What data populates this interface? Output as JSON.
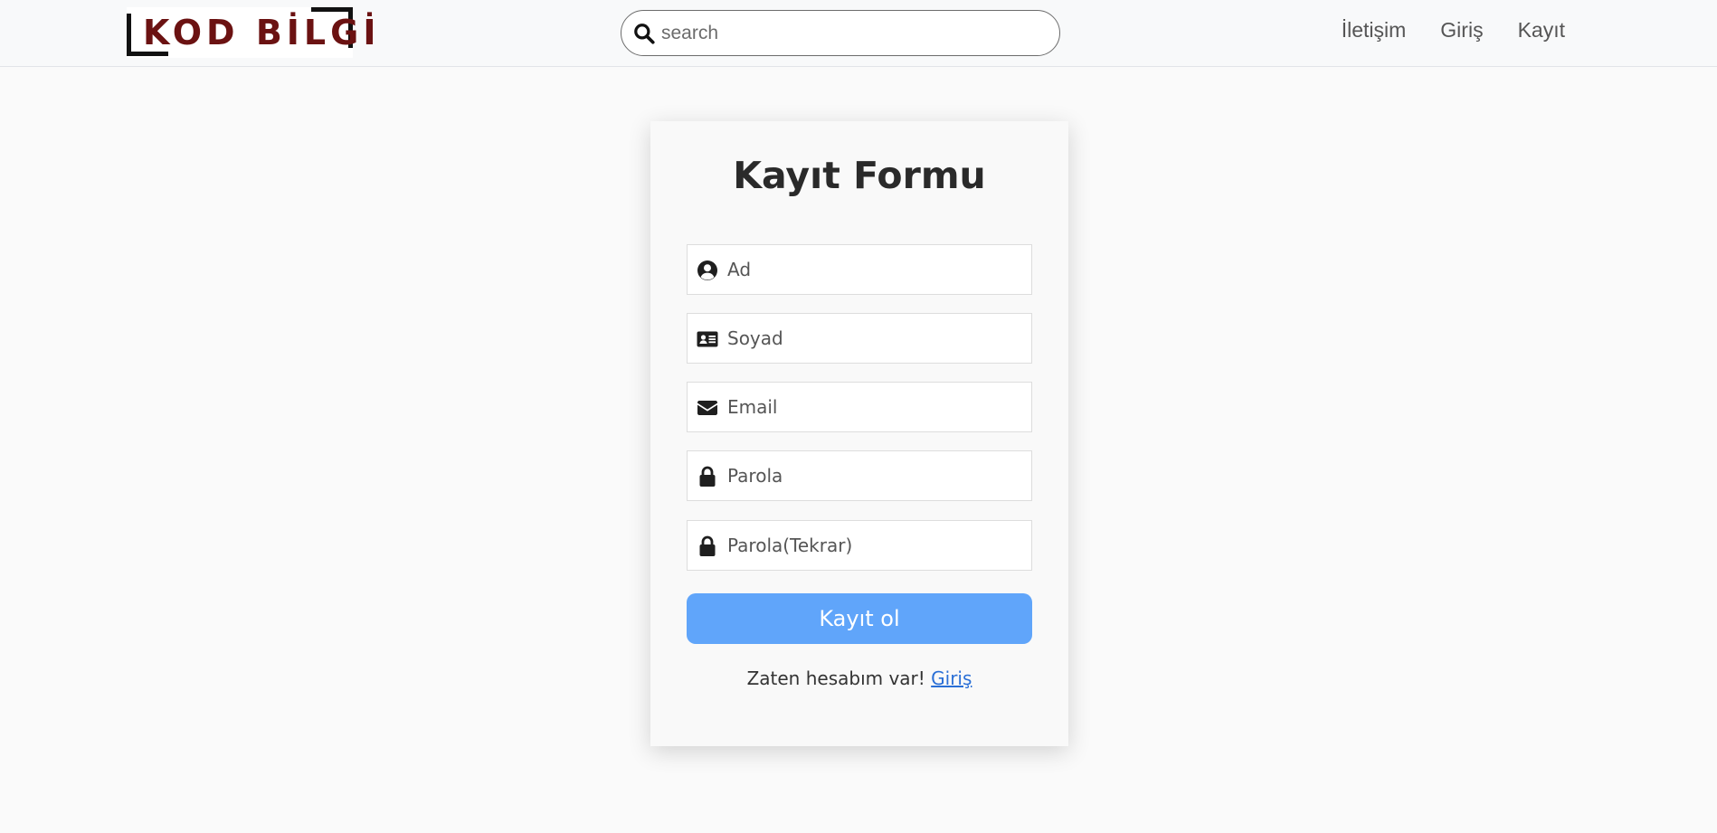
{
  "header": {
    "logo_text": "KOD BİLGİ",
    "search": {
      "placeholder": "search",
      "value": ""
    },
    "nav": {
      "contact": "İletişim",
      "login": "Giriş",
      "register": "Kayıt"
    }
  },
  "form": {
    "title": "Kayıt Formu",
    "fields": {
      "first_name": {
        "placeholder": "Ad",
        "icon": "user-circle-icon",
        "value": ""
      },
      "last_name": {
        "placeholder": "Soyad",
        "icon": "id-card-icon",
        "value": ""
      },
      "email": {
        "placeholder": "Email",
        "icon": "envelope-icon",
        "value": ""
      },
      "password": {
        "placeholder": "Parola",
        "icon": "lock-icon",
        "value": ""
      },
      "password_repeat": {
        "placeholder": "Parola(Tekrar)",
        "icon": "lock-icon",
        "value": ""
      }
    },
    "submit_label": "Kayıt ol",
    "login_prompt": "Zaten hesabım var!",
    "login_link": "Giriş"
  },
  "colors": {
    "accent": "#60a5fa",
    "link": "#2a6fd6",
    "logo": "#6b1212",
    "background": "#fafafa"
  }
}
